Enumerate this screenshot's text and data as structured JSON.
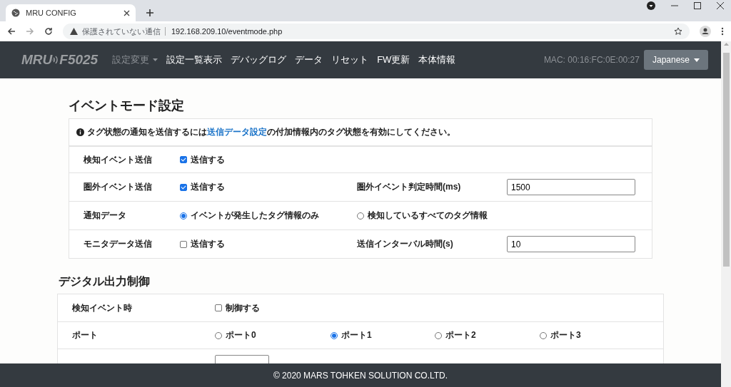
{
  "browser": {
    "tab_title": "MRU CONFIG",
    "security": "保護されていない通信",
    "url": "192.168.209.10/eventmode.php"
  },
  "navbar": {
    "brand": {
      "left": "MRU",
      "right": "F5025"
    },
    "items": [
      {
        "label": "設定変更",
        "dimmed": true,
        "dropdown": true
      },
      {
        "label": "設定一覧表示",
        "dimmed": false,
        "dropdown": false
      },
      {
        "label": "デバッグログ",
        "dimmed": false,
        "dropdown": false
      },
      {
        "label": "データ",
        "dimmed": false,
        "dropdown": false
      },
      {
        "label": "リセット",
        "dimmed": false,
        "dropdown": false
      },
      {
        "label": "FW更新",
        "dimmed": false,
        "dropdown": false
      },
      {
        "label": "本体情報",
        "dimmed": false,
        "dropdown": false
      }
    ],
    "mac": "MAC: 00:16:FC:0E:00:27",
    "language": "Japanese"
  },
  "sections": [
    {
      "title": "イベントモード設定",
      "info": {
        "before": "タグ状態の通知を送信するには",
        "link": "送信データ設定",
        "after": "の付加情報内のタグ状態を有効にしてください。"
      },
      "rows": [
        {
          "kind": "checkbox",
          "label": "検知イベント送信",
          "option": {
            "text": "送信する",
            "checked": true
          }
        },
        {
          "kind": "checkbox",
          "label": "圏外イベント送信",
          "option": {
            "text": "送信する",
            "checked": true
          },
          "extra": {
            "label": "圏外イベント判定時間(ms)",
            "value": "1500"
          }
        },
        {
          "kind": "radio",
          "label": "通知データ",
          "options": [
            {
              "text": "イベントが発生したタグ情報のみ",
              "selected": true
            },
            {
              "text": "検知しているすべてのタグ情報",
              "selected": false
            }
          ]
        },
        {
          "kind": "checkbox",
          "label": "モニタデータ送信",
          "option": {
            "text": "送信する",
            "checked": false
          },
          "extra": {
            "label": "送信インターバル時間(s)",
            "value": "10"
          }
        }
      ]
    },
    {
      "title": "デジタル出力制御",
      "rows": [
        {
          "kind": "checkbox",
          "label": "検知イベント時",
          "option": {
            "text": "制御する",
            "checked": false
          }
        },
        {
          "kind": "radio",
          "label": "ポート",
          "options": [
            {
              "text": "ポート0",
              "selected": false
            },
            {
              "text": "ポート1",
              "selected": true
            },
            {
              "text": "ポート2",
              "selected": false
            },
            {
              "text": "ポート3",
              "selected": false
            }
          ]
        },
        {
          "kind": "partial"
        }
      ]
    }
  ],
  "footer": "© 2020 MARS TOHKEN SOLUTION CO.LTD."
}
